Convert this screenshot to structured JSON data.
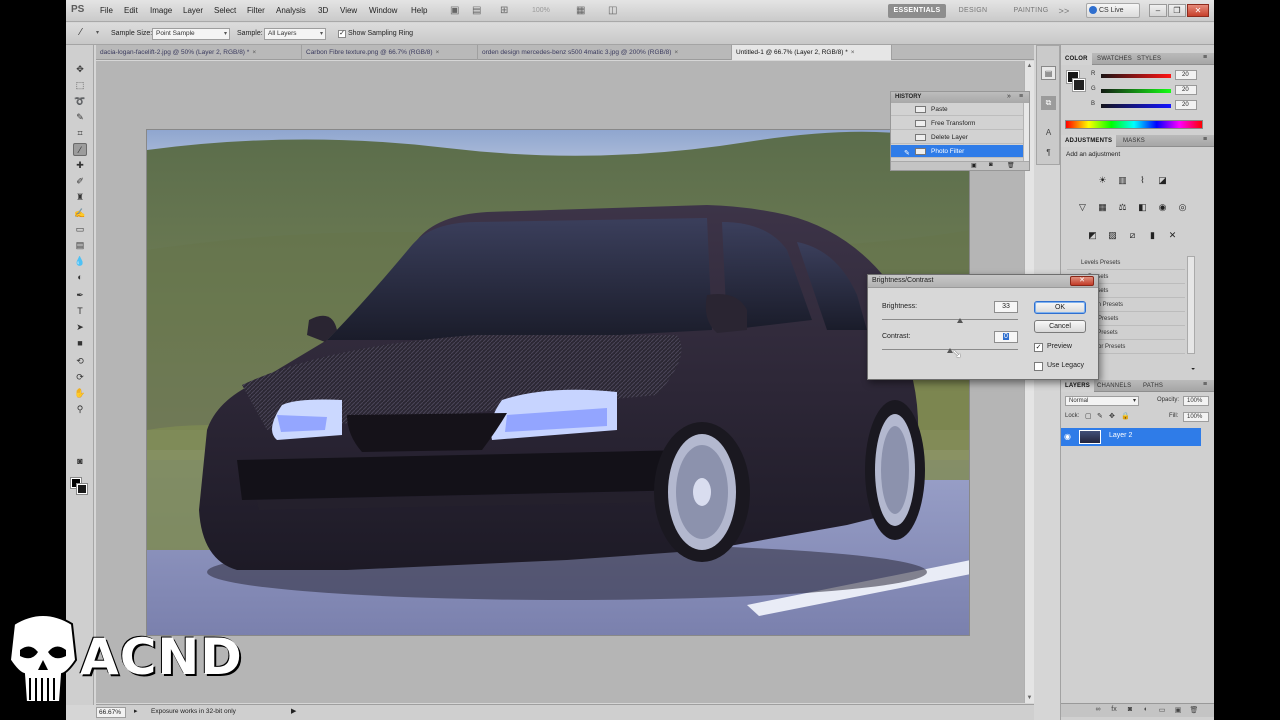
{
  "app": {
    "logo": "PS",
    "menu": [
      "File",
      "Edit",
      "Image",
      "Layer",
      "Select",
      "Filter",
      "Analysis",
      "3D",
      "View",
      "Window",
      "Help"
    ],
    "zoom_display": "100%",
    "workspaces": [
      "ESSENTIALS",
      "DESIGN",
      "PAINTING"
    ],
    "more_workspaces": ">>",
    "cslive": "CS Live"
  },
  "options": {
    "sample_size_label": "Sample Size:",
    "sample_size_value": "Point Sample",
    "sample_label": "Sample:",
    "sample_value": "All Layers",
    "show_ring_label": "Show Sampling Ring"
  },
  "tabs": [
    {
      "label": "dacia-logan-facelift-2.jpg @ 50% (Layer 2, RGB/8) *"
    },
    {
      "label": "Carbon Fibre texture.png @ 66.7% (RGB/8)"
    },
    {
      "label": "orden design mercedes-benz s500 4matic 3.jpg @ 200% (RGB/8)"
    },
    {
      "label": "Untitled-1 @ 66.7% (Layer 2, RGB/8) *"
    }
  ],
  "history": {
    "title": "HISTORY",
    "items": [
      "Paste",
      "Free Transform",
      "Delete Layer",
      "Photo Filter"
    ],
    "active_index": 3
  },
  "color_panel": {
    "tabs": [
      "COLOR",
      "SWATCHES",
      "STYLES"
    ],
    "channels": [
      {
        "label": "R",
        "value": "20",
        "color": "#e02020"
      },
      {
        "label": "G",
        "value": "20",
        "color": "#20b020"
      },
      {
        "label": "B",
        "value": "20",
        "color": "#2040e0"
      }
    ]
  },
  "adjustments": {
    "tabs": [
      "ADJUSTMENTS",
      "MASKS"
    ],
    "heading": "Add an adjustment",
    "presets": [
      "Levels Presets",
      "Curves Presets",
      "Exposure Presets",
      "Hue/Saturation Presets",
      "Black & White Presets",
      "Channel Mixer Presets",
      "Selective Color Presets"
    ],
    "preset_display": [
      "Levels Presets",
      "re Presets",
      "re Presets",
      "turation Presets",
      "White Presets",
      "Mixer Presets",
      "ve Color Presets"
    ]
  },
  "layers": {
    "tabs": [
      "LAYERS",
      "CHANNELS",
      "PATHS"
    ],
    "blend_mode": "Normal",
    "opacity_label": "Opacity:",
    "opacity_value": "100%",
    "lock_label": "Lock:",
    "fill_label": "Fill:",
    "fill_value": "100%",
    "layer_name": "Layer 2"
  },
  "dialog": {
    "title": "Brightness/Contrast",
    "brightness_label": "Brightness:",
    "brightness_value": "33",
    "contrast_label": "Contrast:",
    "contrast_value": "0",
    "ok": "OK",
    "cancel": "Cancel",
    "preview_label": "Preview",
    "preview_checked": true,
    "use_legacy_label": "Use Legacy",
    "use_legacy_checked": false,
    "brightness_level_pct": 57,
    "contrast_level_pct": 50
  },
  "status": {
    "zoom": "66.67%",
    "message": "Exposure works in 32-bit only"
  },
  "watermark": {
    "text": "ACND"
  }
}
